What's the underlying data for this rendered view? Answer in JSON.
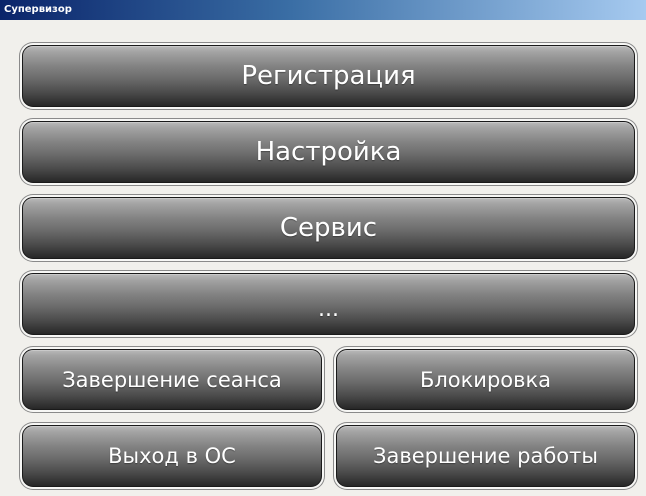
{
  "window": {
    "title": "Супервизор"
  },
  "menu": {
    "registration": "Регистрация",
    "settings": "Настройка",
    "service": "Сервис",
    "more": "...",
    "end_session": "Завершение сеанса",
    "lock": "Блокировка",
    "exit_os": "Выход в ОС",
    "shutdown": "Завершение работы"
  },
  "colors": {
    "title_bar_start": "#0a246a",
    "title_bar_end": "#a6caf0",
    "button_top": "#b9b9b9",
    "button_bottom": "#272727",
    "button_text": "#ffffff",
    "background": "#f1f0ec"
  }
}
